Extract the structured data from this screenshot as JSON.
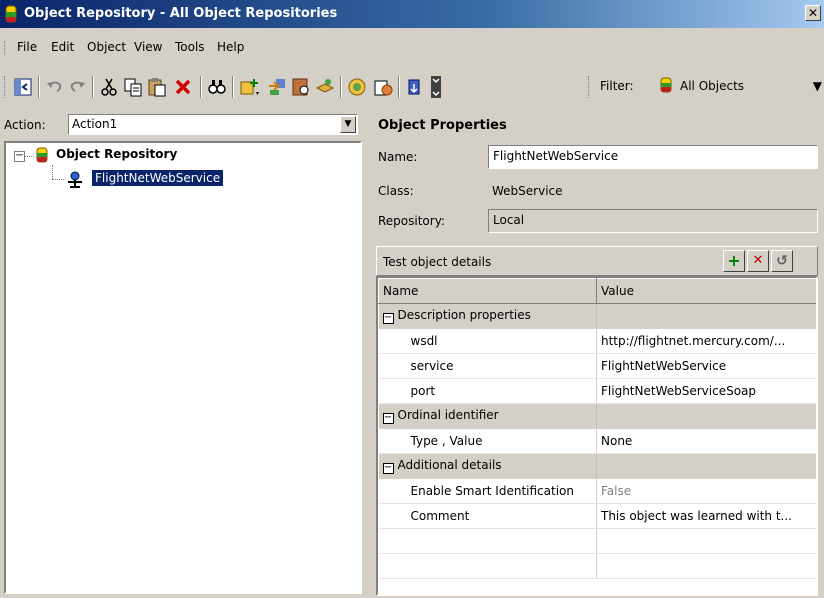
{
  "window": {
    "title": "Object Repository - All Object Repositories",
    "close_glyph": "✕"
  },
  "menu": [
    "File",
    "Edit",
    "Object",
    "View",
    "Tools",
    "Help"
  ],
  "toolbar": {
    "icons": [
      "back-to-tree-icon",
      "undo-icon",
      "redo-icon",
      "cut-icon",
      "copy-icon",
      "paste-icon",
      "delete-icon",
      "find-icon",
      "add-objects-icon",
      "highlight-icon",
      "locate-icon",
      "define-object-icon",
      "object-spy-icon",
      "export-icon",
      "resource-icon"
    ],
    "filter_label": "Filter:",
    "filter_value": "All Objects",
    "dropdown_glyph": "▼"
  },
  "action": {
    "label": "Action:",
    "value": "Action1",
    "dropdown_glyph": "▼"
  },
  "tree": {
    "root_label": "Object Repository",
    "collapse_glyph": "−",
    "child_label": "FlightNetWebService"
  },
  "properties": {
    "title": "Object Properties",
    "name_label": "Name:",
    "name_value": "FlightNetWebService",
    "class_label": "Class:",
    "class_value": "WebService",
    "repository_label": "Repository:",
    "repository_value": "Local"
  },
  "details": {
    "title": "Test object details",
    "add_glyph": "+",
    "remove_glyph": "✕",
    "refresh_glyph": "↺",
    "columns": [
      "Name",
      "Value"
    ],
    "expander_glyph": "−",
    "rows": [
      {
        "type": "category",
        "name": "Description properties",
        "value": ""
      },
      {
        "type": "prop",
        "name": "wsdl",
        "value": "http://flightnet.mercury.com/..."
      },
      {
        "type": "prop",
        "name": "service",
        "value": "FlightNetWebService"
      },
      {
        "type": "prop",
        "name": "port",
        "value": "FlightNetWebServiceSoap"
      },
      {
        "type": "category",
        "name": "Ordinal identifier",
        "value": ""
      },
      {
        "type": "prop",
        "name": "Type , Value",
        "value": "None"
      },
      {
        "type": "category",
        "name": "Additional details",
        "value": ""
      },
      {
        "type": "prop",
        "name": "Enable Smart Identification",
        "value": "False",
        "dim": true
      },
      {
        "type": "prop",
        "name": "Comment",
        "value": "This object was learned with t..."
      },
      {
        "type": "empty",
        "name": "",
        "value": ""
      },
      {
        "type": "empty",
        "name": "",
        "value": ""
      }
    ]
  },
  "colors": {
    "title_bar": "#0a246a",
    "selection": "#0a246a",
    "face": "#d4d0c8",
    "add": "#008000",
    "remove": "#c00000"
  }
}
